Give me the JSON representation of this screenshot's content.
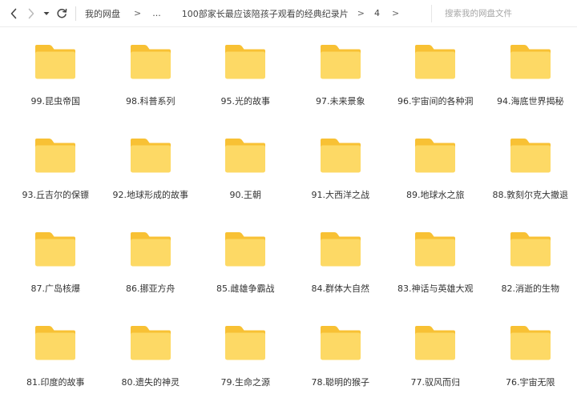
{
  "toolbar": {
    "back_icon": "chevron-left-icon",
    "forward_icon": "chevron-right-icon",
    "history_icon": "caret-down-icon",
    "refresh_icon": "refresh-icon",
    "breadcrumb": {
      "root": "我的网盘",
      "ellipsis": "...",
      "folder": "100部家长最应该陪孩子观看的经典纪录片",
      "current": "4",
      "separator": ">"
    },
    "search_placeholder": "搜索我的网盘文件"
  },
  "colors": {
    "folder_back": "#f8c134",
    "folder_front": "#fdd965",
    "text": "#333333",
    "divider": "#ececec"
  },
  "folders": [
    {
      "name": "99.昆虫帝国"
    },
    {
      "name": "98.科普系列"
    },
    {
      "name": "95.光的故事"
    },
    {
      "name": "97.未来景象"
    },
    {
      "name": "96.宇宙间的各种洞"
    },
    {
      "name": "94.海底世界揭秘"
    },
    {
      "name": "93.丘吉尔的保镖"
    },
    {
      "name": "92.地球形成的故事"
    },
    {
      "name": "90.王朝"
    },
    {
      "name": "91.大西洋之战"
    },
    {
      "name": "89.地球水之旅"
    },
    {
      "name": "88.敦刻尔克大撤退"
    },
    {
      "name": "87.广岛核爆"
    },
    {
      "name": "86.挪亚方舟"
    },
    {
      "name": "85.雌雄争霸战"
    },
    {
      "name": "84.群体大自然"
    },
    {
      "name": "83.神话与英雄大观"
    },
    {
      "name": "82.消逝的生物"
    },
    {
      "name": "81.印度的故事"
    },
    {
      "name": "80.遗失的神灵"
    },
    {
      "name": "79.生命之源"
    },
    {
      "name": "78.聪明的猴子"
    },
    {
      "name": "77.驭风而归"
    },
    {
      "name": "76.宇宙无限"
    }
  ]
}
